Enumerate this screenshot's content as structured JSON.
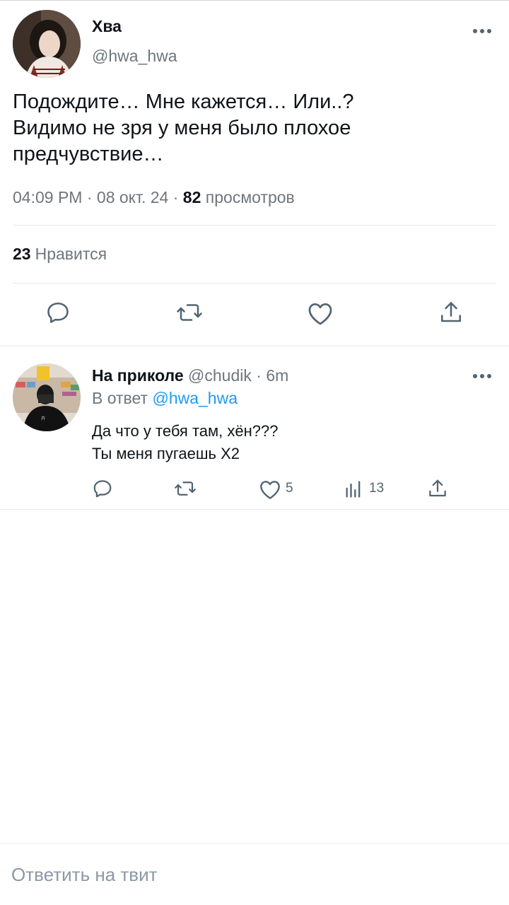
{
  "main_tweet": {
    "author_name": "Хва",
    "author_handle": "@hwa_hwa",
    "text_lines": [
      "Подождите… Мне кажется… Или..?",
      "Видимо не зря у меня было плохое",
      "предчувствие…"
    ],
    "time": "04:09 PM",
    "date": "08 окт. 24",
    "dot": "·",
    "views_count": "82",
    "views_label": "просмотров",
    "likes_count": "23",
    "likes_label": "Нравится",
    "icons": [
      "reply-icon",
      "retweet-icon",
      "like-icon",
      "share-icon",
      "more-icon"
    ]
  },
  "reply": {
    "author_name": "На приколе",
    "author_handle": "@chudik",
    "dot": "·",
    "age": "6m",
    "reply_to_label": "В ответ",
    "reply_to_handle": "@hwa_hwa",
    "text_lines": [
      "Да что у тебя там, хён???",
      "Ты меня пугаешь Х2"
    ],
    "likes_count": "5",
    "views_count": "13",
    "icons": [
      "reply-icon",
      "retweet-icon",
      "like-icon",
      "views-icon",
      "share-icon",
      "more-icon"
    ]
  },
  "reply_bar": {
    "placeholder": "Ответить на твит"
  },
  "colors": {
    "text": "#0f1419",
    "secondary": "#6e767d",
    "link": "#1d9bf0",
    "divider": "#e6e9eb",
    "icon": "#536471"
  }
}
